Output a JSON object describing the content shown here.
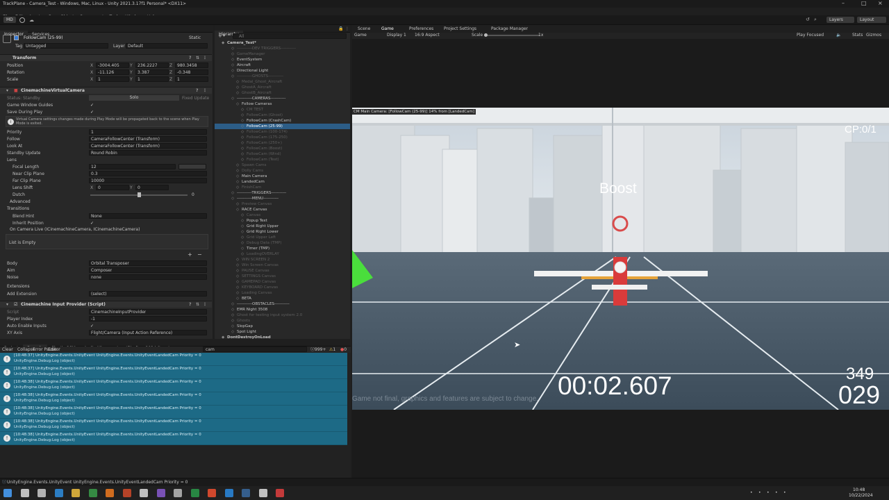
{
  "window": {
    "title": "TrackPlane - Camera_Test - Windows, Mac, Linux - Unity 2021.3.17f1 Personal* <DX11>"
  },
  "menu": [
    "File",
    "Edit",
    "Assets",
    "GameObject",
    "Component",
    "Tools",
    "Window",
    "Help"
  ],
  "toolbar": {
    "account": "MD",
    "layers": "Layers",
    "layout": "Layout"
  },
  "inspector": {
    "tabs": [
      "Inspector",
      "Services"
    ],
    "object_name": "FollowCam (25-99)",
    "static_label": "Static",
    "tag_label": "Tag",
    "tag_value": "Untagged",
    "layer_label": "Layer",
    "layer_value": "Default",
    "transform": {
      "title": "Transform",
      "position_label": "Position",
      "pos_x": "-3004.405",
      "pos_y": "236.2227",
      "pos_z": "980.3458",
      "rotation_label": "Rotation",
      "rot_x": "-11.126",
      "rot_y": "3.387",
      "rot_z": "-0.348",
      "scale_label": "Scale",
      "scale_x": "1",
      "scale_y": "1",
      "scale_z": "1"
    },
    "vcam": {
      "title": "CinemachineVirtualCamera",
      "status_label": "Status: Standby",
      "solo_label": "Solo",
      "fixed_label": "Fixed Update",
      "guides_label": "Game Window Guides",
      "save_label": "Save During Play",
      "info": "Virtual Camera settings changes made during Play Mode will be propagated back to the scene when Play Mode is exited.",
      "priority_label": "Priority",
      "priority_value": "1",
      "follow_label": "Follow",
      "follow_value": "CameraFollowCenter (Transform)",
      "lookat_label": "Look At",
      "lookat_value": "CameraFollowCenter (Transform)",
      "standby_label": "Standby Update",
      "standby_value": "Round Robin",
      "lens_label": "Lens",
      "focal_label": "Focal Length",
      "focal_value": "12",
      "near_label": "Near Clip Plane",
      "near_value": "0.3",
      "far_label": "Far Clip Plane",
      "far_value": "10000",
      "shift_label": "Lens Shift",
      "shift_x": "0",
      "shift_y": "0",
      "dutch_label": "Dutch",
      "dutch_value": "0",
      "advanced_label": "Advanced",
      "transitions_label": "Transitions",
      "blend_label": "Blend Hint",
      "blend_value": "None",
      "inherit_label": "Inherit Position",
      "oncam_label": "On Camera Live (ICinemachineCamera, ICinemachineCamera)",
      "list_empty": "List is Empty",
      "body_label": "Body",
      "body_value": "Orbital Transposer",
      "aim_label": "Aim",
      "aim_value": "Composer",
      "noise_label": "Noise",
      "noise_value": "none",
      "ext_label": "Extensions",
      "addext_label": "Add Extension",
      "addext_value": "(select)"
    },
    "input": {
      "title": "Cinemachine Input Provider (Script)",
      "script_label": "Script",
      "script_value": "CinemachineInputProvider",
      "player_label": "Player Index",
      "player_value": "-1",
      "auto_label": "Auto Enable Inputs",
      "xy_label": "XY Axis",
      "xy_value": "Flight/Camera (Input Action Reference)"
    }
  },
  "hierarchy": {
    "tab": "Hierarchy",
    "search_placeholder": "All",
    "items": [
      {
        "text": "Camera_Test*",
        "indent": 0,
        "state": "bold"
      },
      {
        "text": "-----------DEV TRIGGERS-----------",
        "indent": 2,
        "state": "dim"
      },
      {
        "text": "GameManager",
        "indent": 2,
        "state": "dim"
      },
      {
        "text": "EventSystem",
        "indent": 2,
        "state": ""
      },
      {
        "text": "Aircraft",
        "indent": 2,
        "state": ""
      },
      {
        "text": "Directional Light",
        "indent": 2,
        "state": ""
      },
      {
        "text": "-----------GHOSTS-----------",
        "indent": 2,
        "state": "dim"
      },
      {
        "text": "Medal_Ghost_Aircraft",
        "indent": 3,
        "state": "dim"
      },
      {
        "text": "GhostA_Aircraft",
        "indent": 3,
        "state": "dim"
      },
      {
        "text": "GhostB_Aircraft",
        "indent": 3,
        "state": "dim"
      },
      {
        "text": "-----------CAMERAS-----------",
        "indent": 2,
        "state": ""
      },
      {
        "text": "Follow Cameras",
        "indent": 3,
        "state": ""
      },
      {
        "text": "CM TEST",
        "indent": 4,
        "state": "dim"
      },
      {
        "text": "FollowCam (Ghost)",
        "indent": 4,
        "state": "dim"
      },
      {
        "text": "FollowCam (CrashCam)",
        "indent": 4,
        "state": ""
      },
      {
        "text": "FollowCam (25-99)",
        "indent": 4,
        "state": "sel"
      },
      {
        "text": "FollowCam (100-174)",
        "indent": 4,
        "state": "dim"
      },
      {
        "text": "FollowCam (175-250)",
        "indent": 4,
        "state": "dim"
      },
      {
        "text": "FollowCam (250+)",
        "indent": 4,
        "state": "dim"
      },
      {
        "text": "FollowCam (Boost)",
        "indent": 4,
        "state": "dim"
      },
      {
        "text": "FollowCam (Wind)",
        "indent": 4,
        "state": "dim"
      },
      {
        "text": "FollowCam (Test)",
        "indent": 4,
        "state": "dim"
      },
      {
        "text": "Spawn Cams",
        "indent": 3,
        "state": "dim"
      },
      {
        "text": "Dolly Cams",
        "indent": 3,
        "state": "dim"
      },
      {
        "text": "Main Camera",
        "indent": 3,
        "state": ""
      },
      {
        "text": "LandedCam",
        "indent": 3,
        "state": ""
      },
      {
        "text": "FinishCam",
        "indent": 3,
        "state": "dim"
      },
      {
        "text": "-----------TRIGGERS-----------",
        "indent": 2,
        "state": ""
      },
      {
        "text": "-----------MENU-----------",
        "indent": 2,
        "state": ""
      },
      {
        "text": "Preview Canvas",
        "indent": 3,
        "state": "dim"
      },
      {
        "text": "RACE Canvas",
        "indent": 3,
        "state": ""
      },
      {
        "text": "Canvas",
        "indent": 4,
        "state": "dim"
      },
      {
        "text": "Popup Text",
        "indent": 4,
        "state": ""
      },
      {
        "text": "Grid Right Upper",
        "indent": 4,
        "state": ""
      },
      {
        "text": "Grid Right Lower",
        "indent": 4,
        "state": ""
      },
      {
        "text": "Grid Upper Left",
        "indent": 4,
        "state": "dim"
      },
      {
        "text": "Debug Data (TMP)",
        "indent": 4,
        "state": "dim"
      },
      {
        "text": "Timer (TMP)",
        "indent": 4,
        "state": ""
      },
      {
        "text": "LoadingOVERLAY",
        "indent": 4,
        "state": "dim"
      },
      {
        "text": "WIN SCREEN 2",
        "indent": 3,
        "state": "dim"
      },
      {
        "text": "Win Screen Canvas",
        "indent": 3,
        "state": "dim"
      },
      {
        "text": "PAUSE Canvas",
        "indent": 3,
        "state": "dim"
      },
      {
        "text": "SETTINGS Canvas",
        "indent": 3,
        "state": "dim"
      },
      {
        "text": "GAMEPAD Canvas",
        "indent": 3,
        "state": "dim"
      },
      {
        "text": "KEYBOARD Canvas",
        "indent": 3,
        "state": "dim"
      },
      {
        "text": "Loading Canvas",
        "indent": 3,
        "state": "dim"
      },
      {
        "text": "BETA",
        "indent": 3,
        "state": ""
      },
      {
        "text": "-----------OBSTACLES-----------",
        "indent": 2,
        "state": ""
      },
      {
        "text": "EMR Night 3508",
        "indent": 2,
        "state": ""
      },
      {
        "text": "Ghost for testing input system 2.0",
        "indent": 2,
        "state": "dim"
      },
      {
        "text": "Ghosts",
        "indent": 2,
        "state": "dim"
      },
      {
        "text": "SlopGap",
        "indent": 2,
        "state": ""
      },
      {
        "text": "Spot Light",
        "indent": 2,
        "state": ""
      },
      {
        "text": "DontDestroyOnLoad",
        "indent": 0,
        "state": "bold"
      }
    ]
  },
  "console": {
    "tabs": [
      "Project",
      "Console",
      "Plastic SCM",
      "Audio Mixer",
      "InputBindings2024 (Input..."
    ],
    "buttons": [
      "Clear",
      "Collapse",
      "Error Pause",
      "Editor"
    ],
    "search": "cam",
    "count_info": "999+",
    "count_warn": "1",
    "count_err": "0",
    "entries": [
      {
        "time": "[10:48:37]",
        "msg": "UnityEngine.Events.UnityEvent UnityEngine.Events.UnityEventLandedCam Priority = 0",
        "sub": "UnityEngine.Debug:Log (object)"
      },
      {
        "time": "[10:48:37]",
        "msg": "UnityEngine.Events.UnityEvent UnityEngine.Events.UnityEventLandedCam Priority = 0",
        "sub": "UnityEngine.Debug:Log (object)"
      },
      {
        "time": "[10:48:38]",
        "msg": "UnityEngine.Events.UnityEvent UnityEngine.Events.UnityEventLandedCam Priority = 0",
        "sub": "UnityEngine.Debug:Log (object)"
      },
      {
        "time": "[10:48:38]",
        "msg": "UnityEngine.Events.UnityEvent UnityEngine.Events.UnityEventLandedCam Priority = 0",
        "sub": "UnityEngine.Debug:Log (object)"
      },
      {
        "time": "[10:48:38]",
        "msg": "UnityEngine.Events.UnityEvent UnityEngine.Events.UnityEventLandedCam Priority = 0",
        "sub": "UnityEngine.Debug:Log (object)"
      },
      {
        "time": "[10:48:38]",
        "msg": "UnityEngine.Events.UnityEvent UnityEngine.Events.UnityEventLandedCam Priority = 0",
        "sub": "UnityEngine.Debug:Log (object)"
      },
      {
        "time": "[10:48:38]",
        "msg": "UnityEngine.Events.UnityEvent UnityEngine.Events.UnityEventLandedCam Priority = 0",
        "sub": "UnityEngine.Debug:Log (object)"
      }
    ]
  },
  "game": {
    "tabs": [
      "Scene",
      "Game",
      "Preferences",
      "Project Settings",
      "Package Manager"
    ],
    "display_mode": "Game",
    "display": "Display 1",
    "aspect": "16:9 Aspect",
    "scale_label": "Scale",
    "scale_value": "1x",
    "play_focused": "Play Focused",
    "stats": "Stats",
    "gizmos": "Gizmos",
    "cm_label": "CM Main Camera: [FollowCam (25-99)] 14% from [LandedCam]",
    "checkpoint": "CP:0/1",
    "boost": "Boost",
    "timer": "00:02.607",
    "speed_top": "349",
    "speed_bottom": "029",
    "disclaimer": "Game not final, graphics and features are subject to change."
  },
  "status": {
    "text": "UnityEngine.Events.UnityEvent UnityEngine.Events.UnityEventLandedCam Priority = 0"
  },
  "clock": {
    "time": "10:48",
    "date": "10/22/2024"
  }
}
